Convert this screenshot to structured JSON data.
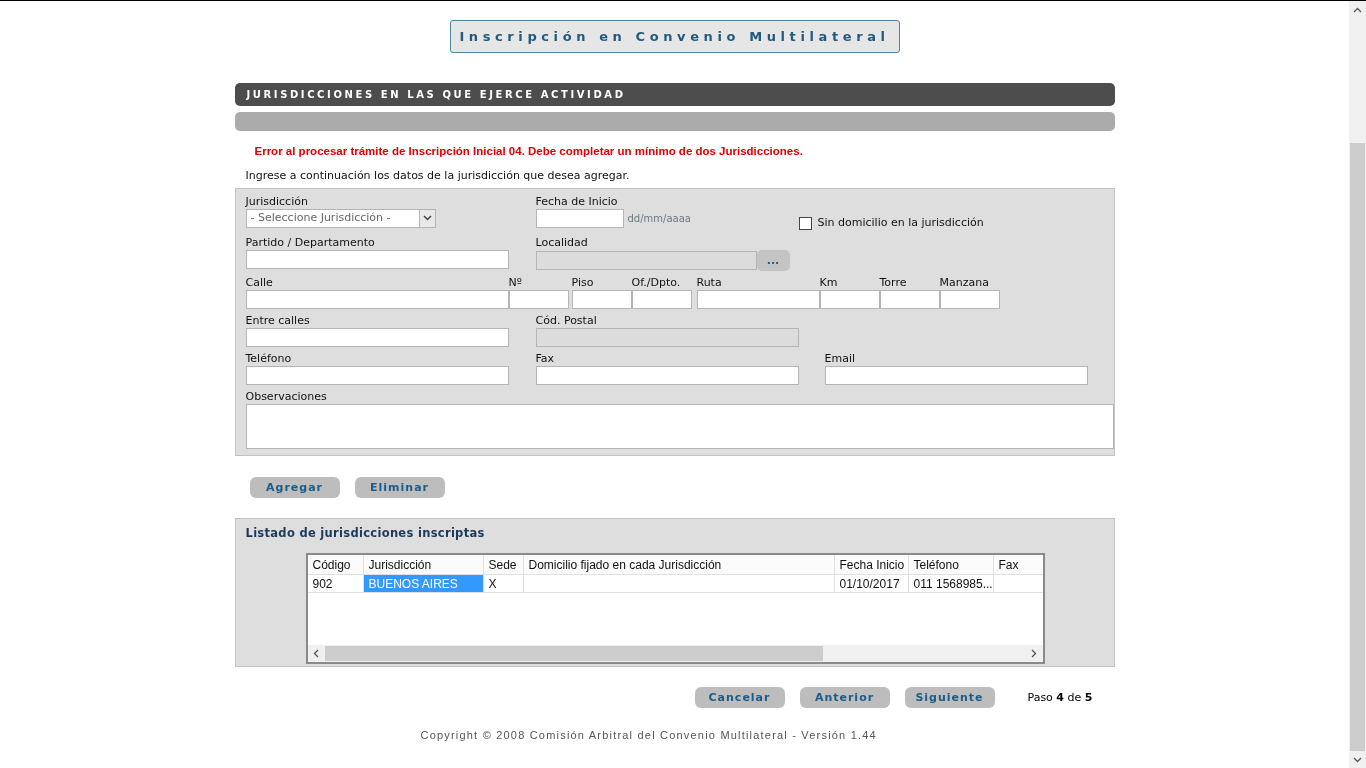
{
  "title": "Inscripción en Convenio Multilateral",
  "section_header": "JURISDICCIONES EN LAS QUE EJERCE ACTIVIDAD",
  "error": "Error al procesar trámite de Inscripción Inicial 04. Debe completar un mínimo de dos Jurisdicciones.",
  "instructions": "Ingrese a continuación los datos de la jurisdicción que desea agregar.",
  "form": {
    "lines": [
      [
        {
          "kind": "select",
          "label": "Jurisdicción",
          "value": "- Seleccione Jurisdicción -"
        },
        {
          "kind": "date",
          "label": "Fecha de Inicio",
          "hint": "dd/mm/aaaa"
        },
        {
          "kind": "checkbox",
          "label": "Sin domicilio en la jurisdicción",
          "checked": false
        }
      ],
      [
        {
          "kind": "text",
          "label": "Partido / Departamento",
          "disabled": false
        },
        {
          "kind": "lookup",
          "label": "Localidad",
          "disabled": true,
          "button": "..."
        }
      ],
      [
        {
          "kind": "text",
          "label": "Calle",
          "disabled": false
        },
        {
          "kind": "text",
          "label": "Nº",
          "disabled": false
        },
        {
          "kind": "text",
          "label": "Piso",
          "disabled": false
        },
        {
          "kind": "text",
          "label": "Of./Dpto.",
          "disabled": false
        },
        {
          "kind": "text",
          "label": "Ruta",
          "disabled": false
        },
        {
          "kind": "text",
          "label": "Km",
          "disabled": false
        },
        {
          "kind": "text",
          "label": "Torre",
          "disabled": false
        },
        {
          "kind": "text",
          "label": "Manzana",
          "disabled": false
        }
      ],
      [
        {
          "kind": "text",
          "label": "Entre calles",
          "disabled": false
        },
        {
          "kind": "text",
          "label": "Cód. Postal",
          "disabled": true
        }
      ],
      [
        {
          "kind": "text",
          "label": "Teléfono",
          "disabled": false
        },
        {
          "kind": "text",
          "label": "Fax",
          "disabled": false
        },
        {
          "kind": "text",
          "label": "Email",
          "disabled": false
        }
      ],
      [
        {
          "kind": "textarea",
          "label": "Observaciones",
          "disabled": false
        }
      ]
    ]
  },
  "form_buttons": [
    "Agregar",
    "Eliminar"
  ],
  "list": {
    "title": "Listado de jurisdicciones inscriptas",
    "columns": [
      "Código",
      "Jurisdicción",
      "Sede",
      "Domicilio fijado en cada Jurisdicción",
      "Fecha Inicio",
      "Teléfono",
      "Fax"
    ],
    "rows": [
      {
        "cells": [
          "902",
          "BUENOS AIRES",
          "X",
          "",
          "01/10/2017",
          "011 1568985...",
          ""
        ],
        "selected": true
      }
    ]
  },
  "nav_buttons": [
    "Cancelar",
    "Anterior",
    "Siguiente"
  ],
  "step": "Paso **4** de **5**",
  "copyright": "Copyright © 2008 Comisión Arbitral del Convenio Multilateral - Versión 1.44"
}
